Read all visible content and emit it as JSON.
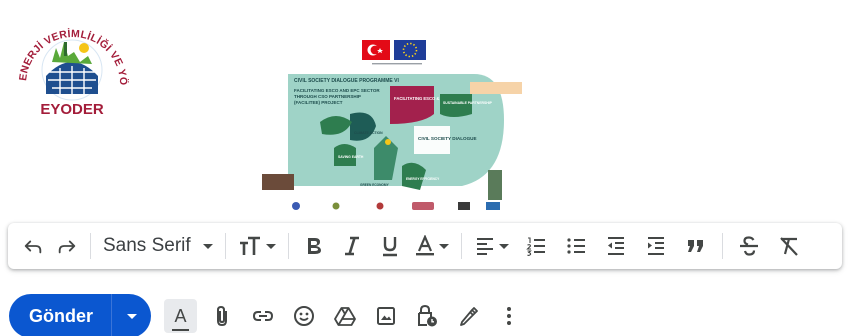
{
  "logo": {
    "arc_text": "ENERJİ VERİMLİLİĞİ VE YÖNETİMİ DERNEĞİ",
    "name": "EYODER"
  },
  "poster": {
    "line1": "CIVIL SOCIETY DIALOGUE PROGRAMME VI",
    "line2": "FACILITATING ESCO AND EPC SECTOR",
    "line3": "THROUGH CSO PARTNERSHIP",
    "line4": "(FACILITEE) PROJECT",
    "tag_escosector": "FACILITATING ESCO & EPC SECTOR",
    "tag_partnership": "SUSTAINABLE PARTNERSHIP",
    "tag_climate": "CLIMATE ACTION",
    "tag_dialogue": "CIVIL SOCIETY DIALOGUE",
    "tag_saving": "SAVING EARTH",
    "tag_green": "GREEN ECONOMY",
    "tag_efficiency": "ENERGY EFFICIENCY",
    "colors": {
      "teal": "#9fd3c7",
      "maroon": "#a3214d",
      "green": "#2e7d4f",
      "peach": "#f6d3a8"
    }
  },
  "toolbar": {
    "font_family": "Sans Serif"
  },
  "compose": {
    "send_label": "Gönder",
    "text_format_letter": "A"
  },
  "colors": {
    "send_blue": "#0b57d0",
    "icon_gray": "#444746"
  }
}
